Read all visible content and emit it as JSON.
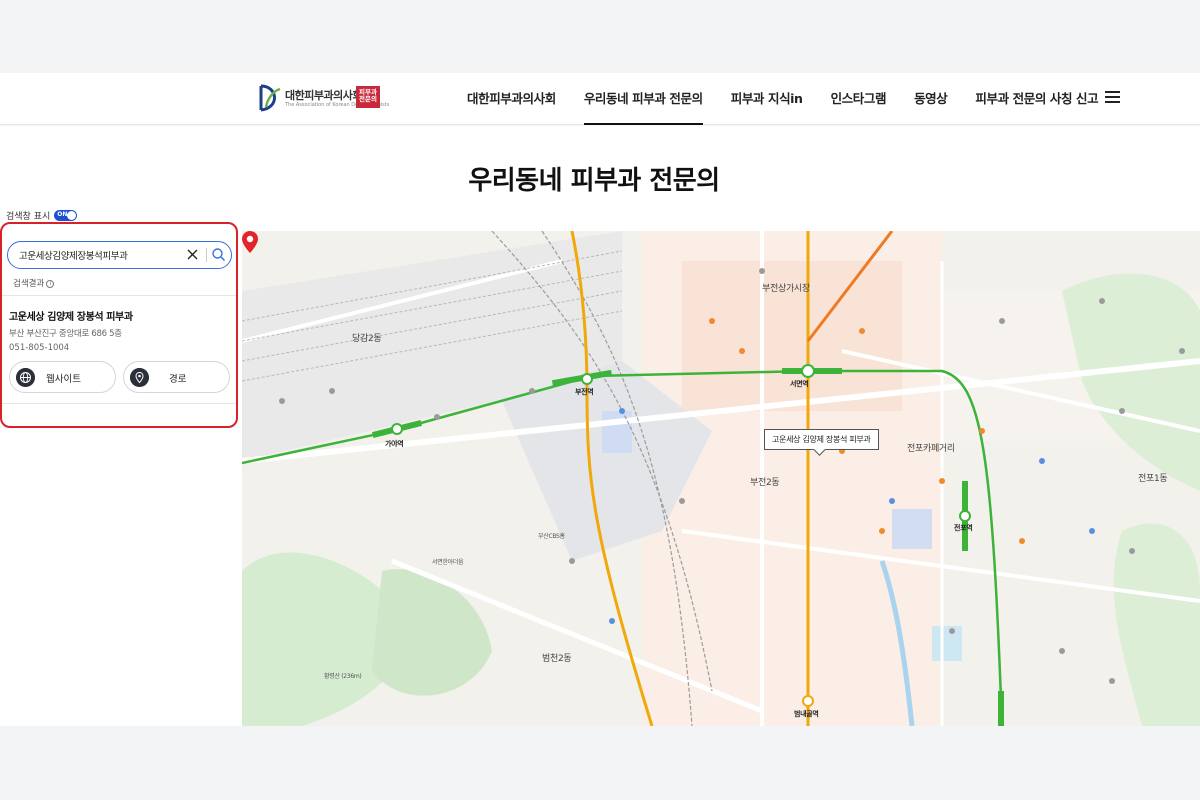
{
  "header": {
    "logo": {
      "name": "대한피부과의사회",
      "subtitle": "The Association of Korean Dermatologists",
      "badge": "피부과 전문의"
    },
    "nav": [
      {
        "label": "대한피부과의사회",
        "active": false
      },
      {
        "label": "우리동네 피부과 전문의",
        "active": true
      },
      {
        "label": "피부과 지식in",
        "active": false
      },
      {
        "label": "인스타그램",
        "active": false
      },
      {
        "label": "동영상",
        "active": false
      },
      {
        "label": "피부과 전문의 사칭 신고",
        "active": false
      }
    ],
    "menu_icon": "hamburger-menu-icon"
  },
  "page_title": "우리동네 피부과 전문의",
  "search_panel": {
    "toggle_label": "검색창 표시",
    "toggle_state": "ON",
    "search_value": "고운세상김양제장봉석피부과",
    "search_placeholder": "",
    "results_label": "검색결과",
    "results": [
      {
        "name": "고운세상 김양제 장봉석 피부과",
        "address": "부산 부산진구 중앙대로 686 5층",
        "phone": "051-805-1004",
        "website_label": "웹사이트",
        "route_label": "경로"
      }
    ],
    "highlight_color": "#d8222a",
    "accent_color": "#3a6fe0"
  },
  "map": {
    "selected_place": "고운세상 김양제 장봉석 피부과",
    "labels": {
      "seomyeon": "서면역",
      "bujeon": "부전역",
      "gaya": "가야역",
      "jeonpo": "전포역",
      "beomnaegol": "범내골역",
      "dangam": "당감2동",
      "bujeonsangga": "부전상가시장",
      "jeonpo_cafe": "전포카페거리",
      "bujeon2": "부전2동",
      "jeonpo1": "전포1동",
      "beomcheon2": "범천2동",
      "hwangnyeong": "황령산\n(236m)",
      "seomyeon_cbs": "부산CBS홈",
      "seomyeon_cinema": "서면한아더움"
    },
    "line_colors": {
      "line1": "#e8a200",
      "line2": "#3db33a"
    }
  }
}
